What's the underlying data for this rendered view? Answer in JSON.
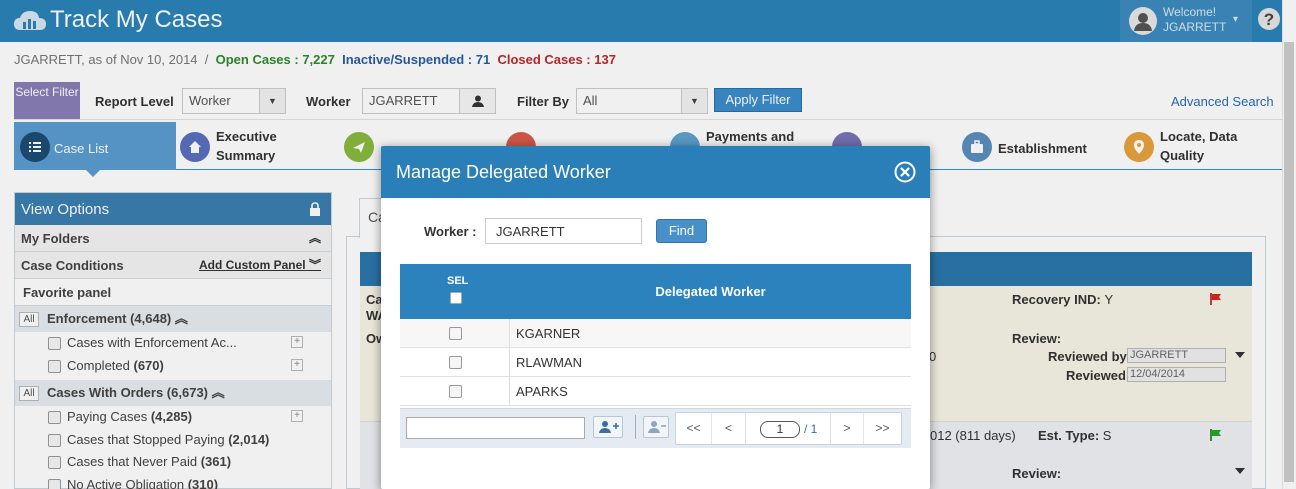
{
  "app": {
    "title": "Track My Cases",
    "welcome": "Welcome!",
    "user": "JGARRETT"
  },
  "stats": {
    "prefix": "JGARRETT, as of Nov 10, 2014",
    "sep": "/",
    "open": "Open Cases : 7,227",
    "inactive": "Inactive/Suspended : 71",
    "closed": "Closed Cases : 137"
  },
  "filters": {
    "select_filter": "Select Filter",
    "report_level_label": "Report Level",
    "report_level_value": "Worker",
    "worker_label": "Worker",
    "worker_value": "JGARRETT",
    "filter_by_label": "Filter By",
    "filter_by_value": "All",
    "apply_label": "Apply Filter",
    "advanced_search": "Advanced Search"
  },
  "tabs": [
    {
      "label": "Case List"
    },
    {
      "label": "Executive Summary"
    },
    {
      "label": ""
    },
    {
      "label": ""
    },
    {
      "label": "Payments and"
    },
    {
      "label": ""
    },
    {
      "label": "Establishment"
    },
    {
      "label": "Locate, Data Quality"
    }
  ],
  "left_panel": {
    "title": "View Options",
    "my_folders": "My Folders",
    "case_conditions": "Case Conditions",
    "add_custom_panel": "Add Custom Panel",
    "favorite_panel": "Favorite panel",
    "all_badge": "All",
    "enforcement_group": "Enforcement (4,648)",
    "enforcement_items": [
      {
        "label": "Cases with Enforcement Ac...",
        "count": ""
      },
      {
        "label": "Completed",
        "count": "(670)"
      }
    ],
    "orders_group": "Cases With Orders (6,673)",
    "orders_items": [
      {
        "label": "Paying Cases",
        "count": "(4,285)"
      },
      {
        "label": "Cases that Stopped Paying",
        "count": "(2,014)"
      },
      {
        "label": "Cases that Never Paid",
        "count": "(361)"
      },
      {
        "label": "No Active Obligation",
        "count": "(310)"
      }
    ]
  },
  "background": {
    "tab_partial": "Ca",
    "recovery_ind": "Recovery IND:",
    "recovery_val": "Y",
    "review": "Review:",
    "reviewed_by": "Reviewed by:",
    "reviewed_by_val": "JGARRETT",
    "reviewed": "Reviewed:",
    "reviewed_val": "12/04/2014",
    "date_partial": "012 (811 days)",
    "est_type": "Est. Type:",
    "est_type_val": "S",
    "review2": "Review:",
    "partial_ca": "Ca",
    "partial_wa": "WA",
    "partial_ow": "Ow",
    "partial_zero": "0"
  },
  "modal": {
    "title": "Manage Delegated Worker",
    "worker_label": "Worker :",
    "worker_value": "JGARRETT",
    "find_label": "Find",
    "sel_header": "SEL",
    "delegated_header": "Delegated Worker",
    "rows": [
      "KGARNER",
      "RLAWMAN",
      "APARKS"
    ],
    "pager": {
      "first": "<<",
      "prev": "<",
      "page": "1",
      "of": "/ 1",
      "next": ">",
      "last": ">>"
    }
  },
  "colors": {
    "brand": "#2b83b8",
    "modal_header": "#2b7fb8",
    "open": "#2e8b2e",
    "inactive": "#2a5ea0",
    "closed": "#c0282d",
    "select_filter": "#8a7fb8"
  }
}
